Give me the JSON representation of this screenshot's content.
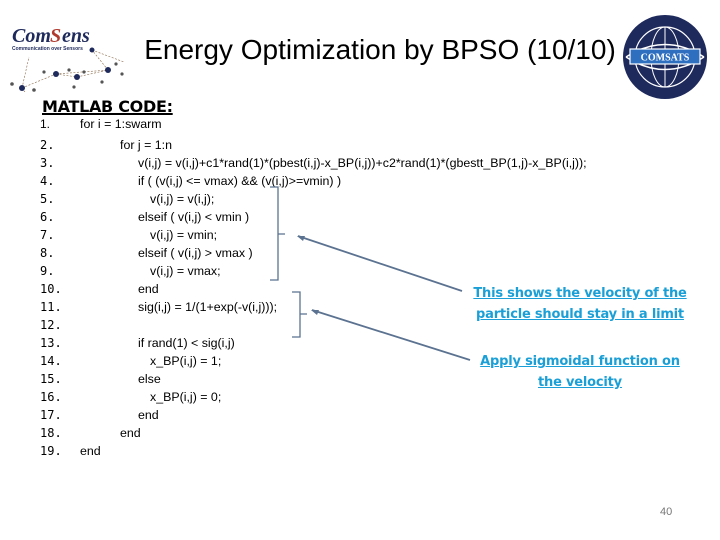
{
  "header": {
    "title": "Energy Optimization by BPSO (10/10)",
    "left_logo": {
      "name": "ComSens",
      "tagline": "Communication over Sensors"
    },
    "right_logo": {
      "name": "COMSATS"
    }
  },
  "section_heading": "MATLAB CODE:",
  "code_lines": [
    {
      "num": "1.",
      "text": "for i = 1:swarm",
      "indent": 0
    },
    {
      "num": "2.",
      "text": "for j = 1:n",
      "indent": 1
    },
    {
      "num": "3.",
      "text": "v(i,j) = v(i,j)+c1*rand(1)*(pbest(i,j)-x_BP(i,j))+c2*rand(1)*(gbestt_BP(1,j)-x_BP(i,j));",
      "indent": 2
    },
    {
      "num": "4.",
      "text": "if ( (v(i,j) <= vmax) && (v(i,j)>=vmin) )",
      "indent": 2
    },
    {
      "num": "5.",
      "text": "v(i,j) = v(i,j);",
      "indent": 3
    },
    {
      "num": "6.",
      "text": "elseif ( v(i,j) < vmin )",
      "indent": 2
    },
    {
      "num": "7.",
      "text": "v(i,j) = vmin;",
      "indent": 3
    },
    {
      "num": "8.",
      "text": "elseif ( v(i,j) > vmax )",
      "indent": 2
    },
    {
      "num": "9.",
      "text": "v(i,j) = vmax;",
      "indent": 3
    },
    {
      "num": "10.",
      "text": "end",
      "indent": 2
    },
    {
      "num": "11.",
      "text": "sig(i,j) = 1/(1+exp(-v(i,j)));",
      "indent": 2
    },
    {
      "num": "12.",
      "text": "",
      "indent": 2
    },
    {
      "num": "13.",
      "text": "if rand(1) < sig(i,j)",
      "indent": 2
    },
    {
      "num": "14.",
      "text": "x_BP(i,j) = 1;",
      "indent": 3
    },
    {
      "num": "15.",
      "text": "else",
      "indent": 2
    },
    {
      "num": "16.",
      "text": "x_BP(i,j) = 0;",
      "indent": 3
    },
    {
      "num": "17.",
      "text": "end",
      "indent": 2
    },
    {
      "num": "18.",
      "text": "end",
      "indent": 1
    },
    {
      "num": "19.",
      "text": "end",
      "indent": 0
    }
  ],
  "annotations": [
    {
      "text_line1": "This shows the velocity of the",
      "text_line2": "particle should stay in a limit"
    },
    {
      "text_line1": "Apply sigmoidal function on",
      "text_line2": "the velocity"
    }
  ],
  "colors": {
    "annotation": "#1a9fd6",
    "arrow": "#5b7290",
    "logo_navy": "#1f2a5c"
  },
  "page_number": "40"
}
